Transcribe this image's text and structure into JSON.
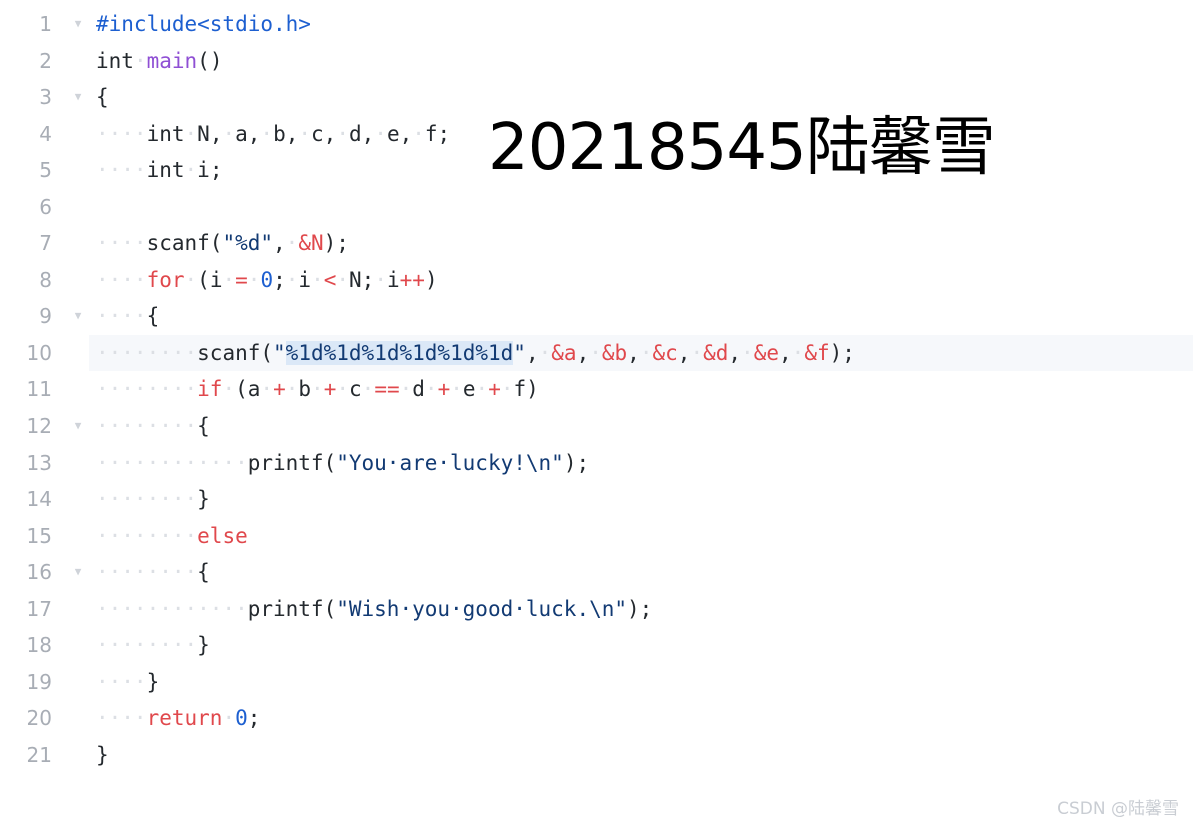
{
  "editor": {
    "language": "c",
    "active_line": 10,
    "colors": {
      "background": "#ffffff",
      "line_number": "#a8adb5",
      "active_line_background": "#f6f8fb",
      "preprocessor": "#1d5fd0",
      "keyword": "#e0484c",
      "operator": "#e0484c",
      "function_name": "#8f4fd4",
      "string": "#123a73",
      "number": "#1d5fd0",
      "plain_text": "#24292e",
      "indent_dot": "#dcdfe4",
      "occurrence_highlight": "#dbe8f7",
      "watermark": "#c9cdd3"
    },
    "fold_marker": "▼",
    "indent_dot_glyph": "·",
    "lines": [
      {
        "number": "1",
        "fold": true,
        "tokens": [
          {
            "text": "#include<stdio.h>",
            "kind": "pre"
          }
        ]
      },
      {
        "number": "2",
        "fold": false,
        "tokens": [
          {
            "text": "int",
            "kind": "plain"
          },
          {
            "text": "·",
            "kind": "dot"
          },
          {
            "text": "main",
            "kind": "fn"
          },
          {
            "text": "()",
            "kind": "plain"
          }
        ]
      },
      {
        "number": "3",
        "fold": true,
        "tokens": [
          {
            "text": "{",
            "kind": "plain"
          }
        ]
      },
      {
        "number": "4",
        "fold": false,
        "tokens": [
          {
            "text": "····",
            "kind": "dot"
          },
          {
            "text": "int",
            "kind": "plain"
          },
          {
            "text": "·",
            "kind": "dot"
          },
          {
            "text": "N,",
            "kind": "plain"
          },
          {
            "text": "·",
            "kind": "dot"
          },
          {
            "text": "a,",
            "kind": "plain"
          },
          {
            "text": "·",
            "kind": "dot"
          },
          {
            "text": "b,",
            "kind": "plain"
          },
          {
            "text": "·",
            "kind": "dot"
          },
          {
            "text": "c,",
            "kind": "plain"
          },
          {
            "text": "·",
            "kind": "dot"
          },
          {
            "text": "d,",
            "kind": "plain"
          },
          {
            "text": "·",
            "kind": "dot"
          },
          {
            "text": "e,",
            "kind": "plain"
          },
          {
            "text": "·",
            "kind": "dot"
          },
          {
            "text": "f;",
            "kind": "plain"
          }
        ]
      },
      {
        "number": "5",
        "fold": false,
        "tokens": [
          {
            "text": "····",
            "kind": "dot"
          },
          {
            "text": "int",
            "kind": "plain"
          },
          {
            "text": "·",
            "kind": "dot"
          },
          {
            "text": "i;",
            "kind": "plain"
          }
        ]
      },
      {
        "number": "6",
        "fold": false,
        "tokens": []
      },
      {
        "number": "7",
        "fold": false,
        "tokens": [
          {
            "text": "····",
            "kind": "dot"
          },
          {
            "text": "scanf(",
            "kind": "plain"
          },
          {
            "text": "\"%d\"",
            "kind": "str"
          },
          {
            "text": ",",
            "kind": "plain"
          },
          {
            "text": "·",
            "kind": "dot"
          },
          {
            "text": "&",
            "kind": "amp"
          },
          {
            "text": "N",
            "kind": "amp"
          },
          {
            "text": ");",
            "kind": "plain"
          }
        ]
      },
      {
        "number": "8",
        "fold": false,
        "tokens": [
          {
            "text": "····",
            "kind": "dot"
          },
          {
            "text": "for",
            "kind": "kw"
          },
          {
            "text": "·",
            "kind": "dot"
          },
          {
            "text": "(i",
            "kind": "plain"
          },
          {
            "text": "·",
            "kind": "dot"
          },
          {
            "text": "=",
            "kind": "op"
          },
          {
            "text": "·",
            "kind": "dot"
          },
          {
            "text": "0",
            "kind": "num"
          },
          {
            "text": ";",
            "kind": "plain"
          },
          {
            "text": "·",
            "kind": "dot"
          },
          {
            "text": "i",
            "kind": "plain"
          },
          {
            "text": "·",
            "kind": "dot"
          },
          {
            "text": "<",
            "kind": "op"
          },
          {
            "text": "·",
            "kind": "dot"
          },
          {
            "text": "N;",
            "kind": "plain"
          },
          {
            "text": "·",
            "kind": "dot"
          },
          {
            "text": "i",
            "kind": "plain"
          },
          {
            "text": "++",
            "kind": "op"
          },
          {
            "text": ")",
            "kind": "plain"
          }
        ]
      },
      {
        "number": "9",
        "fold": true,
        "tokens": [
          {
            "text": "····",
            "kind": "dot"
          },
          {
            "text": "{",
            "kind": "plain"
          }
        ]
      },
      {
        "number": "10",
        "fold": false,
        "active": true,
        "tokens": [
          {
            "text": "········",
            "kind": "dot"
          },
          {
            "text": "scanf(",
            "kind": "plain"
          },
          {
            "text": "\"",
            "kind": "str"
          },
          {
            "text": "%1d",
            "kind": "str-mark"
          },
          {
            "text": "%1d",
            "kind": "str-mark"
          },
          {
            "text": "%1d",
            "kind": "str-mark"
          },
          {
            "text": "%1d",
            "kind": "str-mark"
          },
          {
            "text": "%1d",
            "kind": "str-mark"
          },
          {
            "text": "%1d",
            "kind": "str-mark"
          },
          {
            "text": "\"",
            "kind": "str"
          },
          {
            "text": ",",
            "kind": "plain"
          },
          {
            "text": "·",
            "kind": "dot"
          },
          {
            "text": "&a",
            "kind": "amp"
          },
          {
            "text": ",",
            "kind": "plain"
          },
          {
            "text": "·",
            "kind": "dot"
          },
          {
            "text": "&b",
            "kind": "amp"
          },
          {
            "text": ",",
            "kind": "plain"
          },
          {
            "text": "·",
            "kind": "dot"
          },
          {
            "text": "&c",
            "kind": "amp"
          },
          {
            "text": ",",
            "kind": "plain"
          },
          {
            "text": "·",
            "kind": "dot"
          },
          {
            "text": "&d",
            "kind": "amp"
          },
          {
            "text": ",",
            "kind": "plain"
          },
          {
            "text": "·",
            "kind": "dot"
          },
          {
            "text": "&e",
            "kind": "amp"
          },
          {
            "text": ",",
            "kind": "plain"
          },
          {
            "text": "·",
            "kind": "dot"
          },
          {
            "text": "&f",
            "kind": "amp"
          },
          {
            "text": ");",
            "kind": "plain"
          }
        ]
      },
      {
        "number": "11",
        "fold": false,
        "tokens": [
          {
            "text": "········",
            "kind": "dot"
          },
          {
            "text": "if",
            "kind": "kw"
          },
          {
            "text": "·",
            "kind": "dot"
          },
          {
            "text": "(a",
            "kind": "plain"
          },
          {
            "text": "·",
            "kind": "dot"
          },
          {
            "text": "+",
            "kind": "op"
          },
          {
            "text": "·",
            "kind": "dot"
          },
          {
            "text": "b",
            "kind": "plain"
          },
          {
            "text": "·",
            "kind": "dot"
          },
          {
            "text": "+",
            "kind": "op"
          },
          {
            "text": "·",
            "kind": "dot"
          },
          {
            "text": "c",
            "kind": "plain"
          },
          {
            "text": "·",
            "kind": "dot"
          },
          {
            "text": "==",
            "kind": "op"
          },
          {
            "text": "·",
            "kind": "dot"
          },
          {
            "text": "d",
            "kind": "plain"
          },
          {
            "text": "·",
            "kind": "dot"
          },
          {
            "text": "+",
            "kind": "op"
          },
          {
            "text": "·",
            "kind": "dot"
          },
          {
            "text": "e",
            "kind": "plain"
          },
          {
            "text": "·",
            "kind": "dot"
          },
          {
            "text": "+",
            "kind": "op"
          },
          {
            "text": "·",
            "kind": "dot"
          },
          {
            "text": "f)",
            "kind": "plain"
          }
        ]
      },
      {
        "number": "12",
        "fold": true,
        "tokens": [
          {
            "text": "········",
            "kind": "dot"
          },
          {
            "text": "{",
            "kind": "plain"
          }
        ]
      },
      {
        "number": "13",
        "fold": false,
        "tokens": [
          {
            "text": "············",
            "kind": "dot"
          },
          {
            "text": "printf(",
            "kind": "plain"
          },
          {
            "text": "\"You·are·lucky!\\n\"",
            "kind": "str"
          },
          {
            "text": ");",
            "kind": "plain"
          }
        ]
      },
      {
        "number": "14",
        "fold": false,
        "tokens": [
          {
            "text": "········",
            "kind": "dot"
          },
          {
            "text": "}",
            "kind": "plain"
          }
        ]
      },
      {
        "number": "15",
        "fold": false,
        "tokens": [
          {
            "text": "········",
            "kind": "dot"
          },
          {
            "text": "else",
            "kind": "kw"
          }
        ]
      },
      {
        "number": "16",
        "fold": true,
        "tokens": [
          {
            "text": "········",
            "kind": "dot"
          },
          {
            "text": "{",
            "kind": "plain"
          }
        ]
      },
      {
        "number": "17",
        "fold": false,
        "tokens": [
          {
            "text": "············",
            "kind": "dot"
          },
          {
            "text": "printf(",
            "kind": "plain"
          },
          {
            "text": "\"Wish·you·good·luck.\\n\"",
            "kind": "str"
          },
          {
            "text": ");",
            "kind": "plain"
          }
        ]
      },
      {
        "number": "18",
        "fold": false,
        "tokens": [
          {
            "text": "········",
            "kind": "dot"
          },
          {
            "text": "}",
            "kind": "plain"
          }
        ]
      },
      {
        "number": "19",
        "fold": false,
        "tokens": [
          {
            "text": "····",
            "kind": "dot"
          },
          {
            "text": "}",
            "kind": "plain"
          }
        ]
      },
      {
        "number": "20",
        "fold": false,
        "tokens": [
          {
            "text": "····",
            "kind": "dot"
          },
          {
            "text": "return",
            "kind": "kw"
          },
          {
            "text": "·",
            "kind": "dot"
          },
          {
            "text": "0",
            "kind": "num"
          },
          {
            "text": ";",
            "kind": "plain"
          }
        ]
      },
      {
        "number": "21",
        "fold": false,
        "tokens": [
          {
            "text": "}",
            "kind": "plain"
          }
        ]
      }
    ]
  },
  "overlay": {
    "student_label": "20218545陆馨雪"
  },
  "watermark": {
    "text": "CSDN @陆馨雪"
  }
}
